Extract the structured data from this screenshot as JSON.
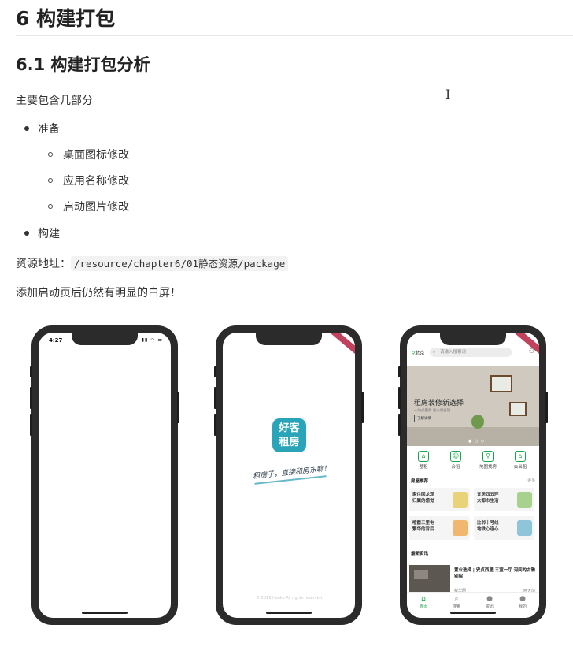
{
  "doc": {
    "h1": "6 构建打包",
    "h2": "6.1 构建打包分析",
    "intro": "主要包含几部分",
    "list": {
      "prepare": "准备",
      "prepare_items": [
        "桌面图标修改",
        "应用名称修改",
        "启动图片修改"
      ],
      "build": "构建"
    },
    "resource_label": "资源地址：",
    "resource_path": "/resource/chapter6/01静态资源/package",
    "note": "添加启动页后仍然有明显的白屏！"
  },
  "phones": {
    "blank": {
      "time": "4:27",
      "status_icons": "▮▮ ◠ ▬"
    },
    "splash": {
      "icon_text": [
        "好客",
        "租房"
      ],
      "slogan": "租房子，直接和房东聊！",
      "copyright": "© 2019 Haoke All rights reserved"
    },
    "home": {
      "city": "北京",
      "search_placeholder": "请输入搜索词",
      "banner_title": "租房装修新选择",
      "banner_sub": "一站式服务 省心更省钱",
      "banner_btn": "了解详情",
      "nav": [
        "整租",
        "合租",
        "地图找房",
        "去出租"
      ],
      "recommend_title": "房屋推荐",
      "recommend_more": "更多",
      "cards": [
        {
          "title": [
            "家住回龙观",
            "归属的感觉"
          ]
        },
        {
          "title": [
            "宜居四五环",
            "大都市生活"
          ]
        },
        {
          "title": [
            "喧嚣三里屯",
            "繁华的背后"
          ]
        },
        {
          "title": [
            "比邻十号线",
            "地铁心连心"
          ]
        }
      ],
      "news_title": "最新资讯",
      "news": {
        "title": "置业选择 | 安贞西里 三室一厅 河间的古雅别院",
        "source": "新华网",
        "time": "两天前"
      },
      "tabs": [
        "首页",
        "搜索",
        "资讯",
        "我的"
      ]
    }
  },
  "colors": {
    "accent": "#1aa44a",
    "splash_icon": "#2aa4b8",
    "phone_frame": "#2b2b2b",
    "ribbon": "#c0425c"
  }
}
